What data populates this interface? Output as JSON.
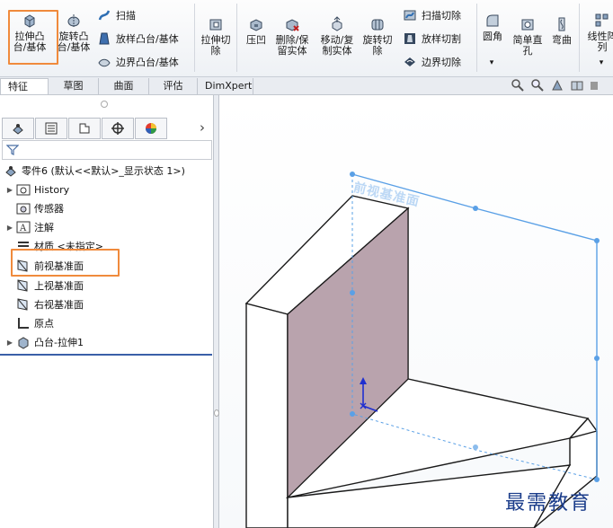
{
  "ribbon": {
    "extrude_boss": "拉伸凸\n台/基体",
    "revolve_boss": "旋转凸\n台/基体",
    "sweep": "扫描",
    "loft_boss": "放样凸台/基体",
    "boundary_boss": "边界凸台/基体",
    "extrude_cut": "拉伸切\n除",
    "indent": "压凹",
    "delete_keep_body": "删除/保\n留实体",
    "move_copy_body": "移动/复\n制实体",
    "revolve_cut": "旋转切\n除",
    "sweep_cut": "扫描切除",
    "loft_cut": "放样切割",
    "boundary_cut": "边界切除",
    "fillet": "圆角",
    "simple_hole": "简单直\n孔",
    "flex": "弯曲",
    "linear_pattern": "线性阵\n列",
    "dropdown_glyph": "▾"
  },
  "tabs": [
    {
      "label": "特征",
      "active": true
    },
    {
      "label": "草图",
      "active": false
    },
    {
      "label": "曲面",
      "active": false
    },
    {
      "label": "评估",
      "active": false
    },
    {
      "label": "DimXpert",
      "active": false
    }
  ],
  "panel": {
    "more_glyph": "›",
    "filter_icon": "filter-icon",
    "tree": {
      "root": "零件6  (默认<<默认>_显示状态 1>)",
      "history": "History",
      "sensors": "传感器",
      "annotations": "注解",
      "material": "材质 <未指定>",
      "front_plane": "前视基准面",
      "top_plane": "上视基准面",
      "right_plane": "右视基准面",
      "origin": "原点",
      "boss_extrude": "凸台-拉伸1"
    }
  },
  "viewport": {
    "plane_label": "前视基准面",
    "watermark": "最需教育"
  },
  "colors": {
    "highlight": "#f08a3c",
    "plane_edge": "#5aa0e6",
    "plane_face": "#b9a3ad",
    "wire": "#1a1a1a"
  }
}
